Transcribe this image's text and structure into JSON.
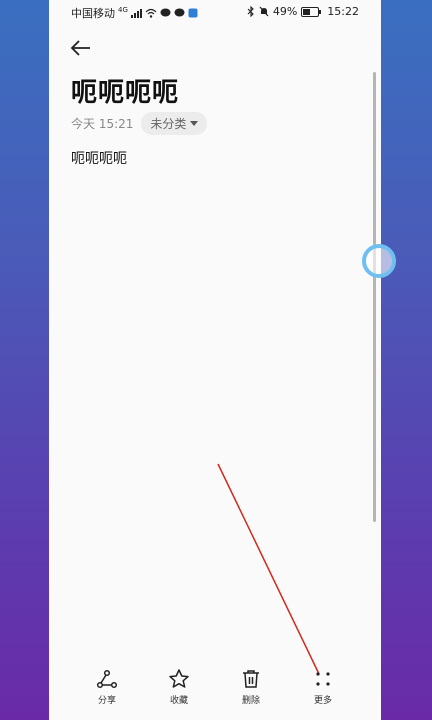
{
  "status_bar": {
    "carrier": "中国移动",
    "network_type": "4G",
    "battery_percent": "49%",
    "battery_level": 0.49,
    "time": "15:22"
  },
  "note": {
    "title": "呃呃呃呃",
    "date": "今天 15:21",
    "category": "未分类",
    "content": "呃呃呃呃"
  },
  "bottom_bar": {
    "share": "分享",
    "favorite": "收藏",
    "delete": "删除",
    "more": "更多"
  },
  "icons": {
    "back": "back-arrow-icon",
    "share": "share-icon",
    "favorite": "star-icon",
    "delete": "trash-icon",
    "more": "more-dots-icon"
  },
  "colors": {
    "annotation_line": "#d22a1e",
    "edge_ring": "#6fc0f0"
  }
}
